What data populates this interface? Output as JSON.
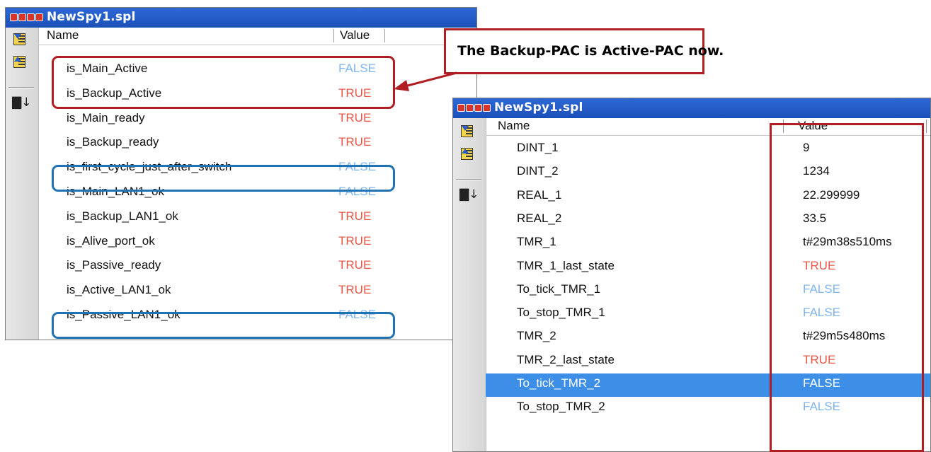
{
  "colors": {
    "titlebar": "#1f57c8",
    "true_color": "#e8574a",
    "false_color": "#7fb5ee",
    "highlight_red": "#b01e23",
    "highlight_blue": "#1f73b5",
    "selection": "#3d8ee6"
  },
  "icons": [
    "window-dots-icon",
    "move-down-icon",
    "move-up-icon",
    "sort-icon"
  ],
  "callout": {
    "text": "The Backup-PAC is Active-PAC now."
  },
  "left_window": {
    "title": "NewSpy1.spl",
    "col_name": "Name",
    "col_value": "Value",
    "rows": [
      {
        "name": "is_Main_Active",
        "value": "FALSE"
      },
      {
        "name": "is_Backup_Active",
        "value": "TRUE"
      },
      {
        "name": "is_Main_ready",
        "value": "TRUE"
      },
      {
        "name": "is_Backup_ready",
        "value": "TRUE"
      },
      {
        "name": "is_first_cycle_just_after_switch",
        "value": "FALSE"
      },
      {
        "name": "is_Main_LAN1_ok",
        "value": "FALSE"
      },
      {
        "name": "is_Backup_LAN1_ok",
        "value": "TRUE"
      },
      {
        "name": "is_Alive_port_ok",
        "value": "TRUE"
      },
      {
        "name": "is_Passive_ready",
        "value": "TRUE"
      },
      {
        "name": "is_Active_LAN1_ok",
        "value": "TRUE"
      },
      {
        "name": "is_Passive_LAN1_ok",
        "value": "FALSE"
      }
    ]
  },
  "right_window": {
    "title": "NewSpy1.spl",
    "col_name": "Name",
    "col_value": "Value",
    "selected_row": "To_tick_TMR_2",
    "rows": [
      {
        "name": "DINT_1",
        "value": "9"
      },
      {
        "name": "DINT_2",
        "value": "1234"
      },
      {
        "name": "REAL_1",
        "value": "22.299999"
      },
      {
        "name": "REAL_2",
        "value": "33.5"
      },
      {
        "name": "TMR_1",
        "value": "t#29m38s510ms"
      },
      {
        "name": "TMR_1_last_state",
        "value": "TRUE"
      },
      {
        "name": "To_tick_TMR_1",
        "value": "FALSE"
      },
      {
        "name": "To_stop_TMR_1",
        "value": "FALSE"
      },
      {
        "name": "TMR_2",
        "value": "t#29m5s480ms"
      },
      {
        "name": "TMR_2_last_state",
        "value": "TRUE"
      },
      {
        "name": "To_tick_TMR_2",
        "value": "FALSE"
      },
      {
        "name": "To_stop_TMR_2",
        "value": "FALSE"
      }
    ]
  }
}
